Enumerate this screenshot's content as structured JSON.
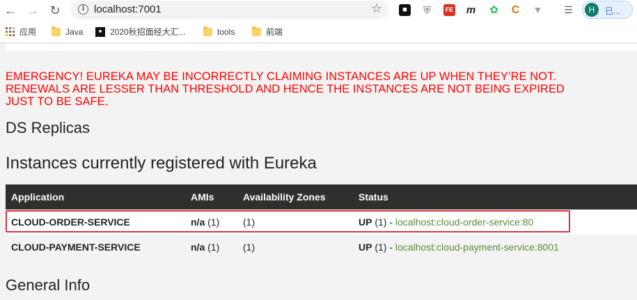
{
  "browser": {
    "url": "localhost:7001",
    "profile_initial": "H",
    "profile_label": "已...",
    "extensions": [
      "tabbed-icon",
      "shield-icon",
      "fe-icon",
      "m-icon",
      "evernote-icon",
      "c-icon",
      "v-icon",
      "playlist-icon"
    ]
  },
  "bookmarks": [
    {
      "label": "应用",
      "icon": "apps-icon"
    },
    {
      "label": "Java",
      "icon": "folder-icon"
    },
    {
      "label": "2020秋招面经大汇...",
      "icon": "site-icon"
    },
    {
      "label": "tools",
      "icon": "folder-icon"
    },
    {
      "label": "前端",
      "icon": "folder-icon"
    }
  ],
  "page": {
    "emergency_line1": "EMERGENCY! EUREKA MAY BE INCORRECTLY CLAIMING INSTANCES ARE UP WHEN THEY’RE NOT.",
    "emergency_line2": "RENEWALS ARE LESSER THAN THRESHOLD AND HENCE THE INSTANCES ARE NOT BEING EXPIRED",
    "emergency_line3": "JUST TO BE SAFE.",
    "ds_replicas_heading": "DS Replicas",
    "instances_heading": "Instances currently registered with Eureka",
    "general_info_heading": "General Info"
  },
  "table": {
    "headers": [
      "Application",
      "AMIs",
      "Availability Zones",
      "Status"
    ],
    "rows": [
      {
        "application": "CLOUD-ORDER-SERVICE",
        "ami_value": "n/a",
        "ami_count": "(1)",
        "zones": "(1)",
        "status": "UP",
        "status_count": "(1) -",
        "instance": "localhost:cloud-order-service:80"
      },
      {
        "application": "CLOUD-PAYMENT-SERVICE",
        "ami_value": "n/a",
        "ami_count": "(1)",
        "zones": "(1)",
        "status": "UP",
        "status_count": "(1) -",
        "instance": "localhost:cloud-payment-service:8001"
      }
    ]
  },
  "colors": {
    "emergency": "#ff0000",
    "table_header": "#302f2e",
    "link": "#5a8a3a",
    "highlight_box": "#d4363f"
  }
}
